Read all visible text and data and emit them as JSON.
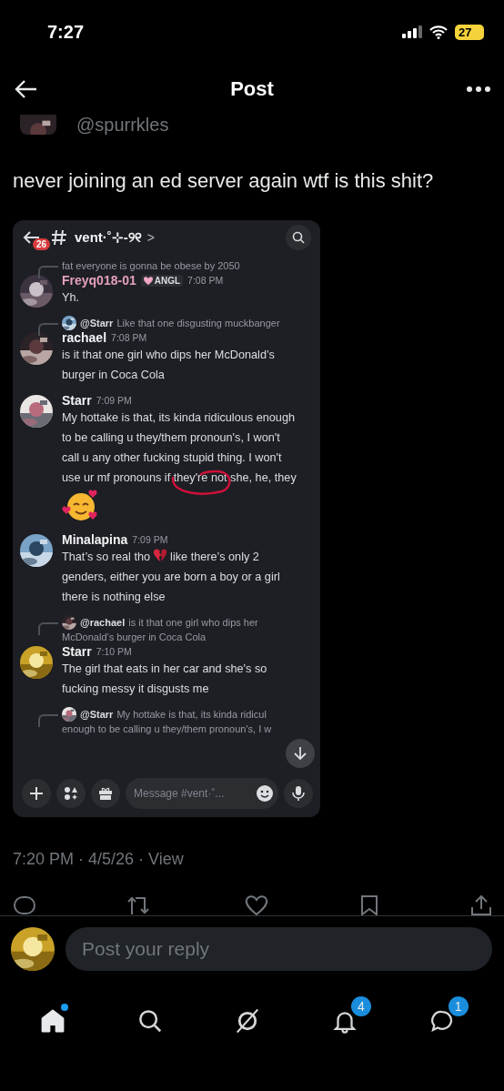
{
  "status_bar": {
    "time": "7:27",
    "battery": "27"
  },
  "header": {
    "title": "Post"
  },
  "post": {
    "handle": "@spurrkles",
    "text": "never joining an ed server again wtf is this shit?",
    "meta": "7:20 PM · 4/5/26 · View"
  },
  "discord": {
    "unread_count": "26",
    "channel": "vent·˚⊹-୨୧",
    "chevron": ">",
    "placeholder": "Message #vent·˚...",
    "messages": [
      {
        "reply": {
          "text": "fat everyone is gonna be obese by 2050"
        },
        "author": "Freyq018-01",
        "color": "#e3a1bd",
        "tag": "ANGL",
        "time": "7:08 PM",
        "parts": [
          {
            "kind": "text",
            "text": "Yh."
          }
        ]
      },
      {
        "reply": {
          "author": "@Starr",
          "text": "Like that one disgusting muckbanger"
        },
        "author": "rachael",
        "color": "#f2f3f5",
        "time": "7:08 PM",
        "parts": [
          {
            "kind": "text",
            "text": "is it that one girl who dips her McDonald’s burger in Coca Cola"
          }
        ]
      },
      {
        "author": "Starr",
        "color": "#f2f3f5",
        "time": "7:09 PM",
        "annotated": true,
        "parts": [
          {
            "kind": "block",
            "text": "My hottake is that, its kinda ridiculous enough"
          },
          {
            "kind": "block",
            "text": "to be calling u they/them pronoun's, I won't"
          },
          {
            "kind": "block",
            "text": "call u any other fucking stupid thing. I won't"
          },
          {
            "kind": "block",
            "text": "use ur mf pronouns if they're not she, he, they"
          }
        ],
        "sticker": true
      },
      {
        "author": "Minalapina",
        "color": "#f2f3f5",
        "time": "7:09 PM",
        "parts": [
          {
            "kind": "text",
            "text": "That’s so real tho"
          },
          {
            "kind": "broken-heart"
          },
          {
            "kind": "text",
            "text": "like there’s only 2"
          },
          {
            "kind": "block",
            "text": "genders, either you are born a boy or a girl"
          },
          {
            "kind": "block",
            "text": "there is nothing else"
          }
        ]
      },
      {
        "reply": {
          "author": "@rachael",
          "text": "is it that one girl who dips her",
          "text_2": "McDonald’s burger in Coca Cola"
        },
        "author": "Starr",
        "color": "#f2f3f5",
        "time": "7:10 PM",
        "parts": [
          {
            "kind": "block",
            "text": "The girl that eats in her car and she's so"
          },
          {
            "kind": "block",
            "text": "fucking messy it disgusts me"
          }
        ]
      },
      {
        "reply": {
          "author": "@Starr",
          "text": "My hottake is that, its kinda ridicul",
          "text_2": "enough to be calling u they/them pronoun's, I w"
        }
      }
    ]
  },
  "reply_field": {
    "placeholder": "Post your reply"
  },
  "tab_bar": [
    {
      "kind": "home",
      "selected": true,
      "dot": true
    },
    {
      "kind": "search",
      "selected": false
    },
    {
      "kind": "grok",
      "selected": false
    },
    {
      "kind": "notifications",
      "selected": false,
      "badge": "4"
    },
    {
      "kind": "messages",
      "selected": false,
      "badge": "1"
    }
  ]
}
